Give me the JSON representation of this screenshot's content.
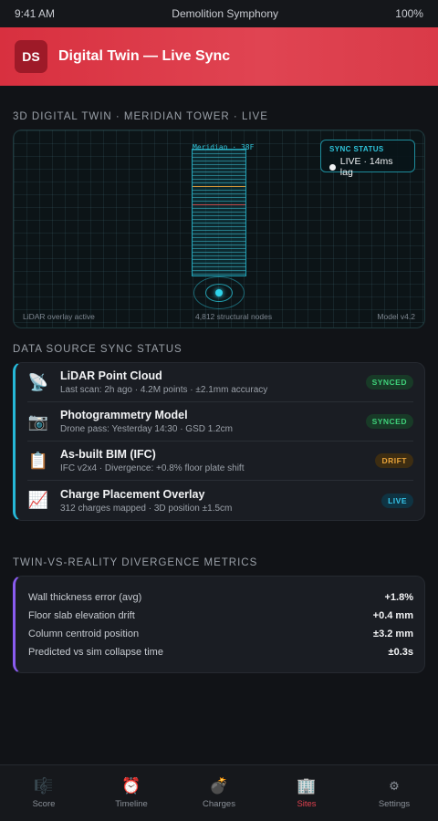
{
  "status_bar": {
    "time": "9:41 AM",
    "app_name": "Demolition Symphony",
    "battery": "100%"
  },
  "header": {
    "logo": "DS",
    "title": "Digital Twin — Live Sync"
  },
  "twin": {
    "section_title": "3D DIGITAL TWIN · MERIDIAN TOWER · LIVE",
    "tower_label": "Meridian · 38F",
    "sync_box": {
      "title": "SYNC STATUS",
      "state": "LIVE · 14ms lag"
    },
    "footer_left": "LiDAR overlay active",
    "footer_mid": "4,812 structural nodes",
    "footer_right": "Model v4.2"
  },
  "sources": {
    "section_title": "DATA SOURCE SYNC STATUS",
    "items": [
      {
        "icon": "satellite-dish-icon",
        "glyph": "📡",
        "name": "LiDAR Point Cloud",
        "detail": "Last scan: 2h ago · 4.2M points · ±2.1mm accuracy",
        "badge": "SYNCED",
        "badge_type": "synced"
      },
      {
        "icon": "camera-icon",
        "glyph": "📷",
        "name": "Photogrammetry Model",
        "detail": "Drone pass: Yesterday 14:30 · GSD 1.2cm",
        "badge": "SYNCED",
        "badge_type": "synced"
      },
      {
        "icon": "clipboard-icon",
        "glyph": "📋",
        "name": "As-built BIM (IFC)",
        "detail": "IFC v2x4 · Divergence: +0.8% floor plate shift",
        "badge": "DRIFT",
        "badge_type": "drift"
      },
      {
        "icon": "chart-icon",
        "glyph": "📈",
        "name": "Charge Placement Overlay",
        "detail": "312 charges mapped · 3D position ±1.5cm",
        "badge": "LIVE",
        "badge_type": "live"
      }
    ]
  },
  "metrics": {
    "section_title": "TWIN-VS-REALITY DIVERGENCE METRICS",
    "rows": [
      {
        "label": "Wall thickness error (avg)",
        "value": "+1.8%"
      },
      {
        "label": "Floor slab elevation drift",
        "value": "+0.4 mm"
      },
      {
        "label": "Column centroid position",
        "value": "±3.2 mm"
      },
      {
        "label": "Predicted vs sim collapse time",
        "value": "±0.3s"
      }
    ]
  },
  "tabs": [
    {
      "label": "Score",
      "glyph": "🎼",
      "icon": "music-score-icon"
    },
    {
      "label": "Timeline",
      "glyph": "⏰",
      "icon": "alarm-clock-icon"
    },
    {
      "label": "Charges",
      "glyph": "💣",
      "icon": "bomb-icon"
    },
    {
      "label": "Sites",
      "glyph": "🏢",
      "icon": "building-icon"
    },
    {
      "label": "Settings",
      "glyph": "⚙",
      "icon": "gear-icon"
    }
  ],
  "colors": {
    "accent": "#e0404e",
    "cyan": "#26b8d8",
    "purple": "#8a5cf0"
  }
}
